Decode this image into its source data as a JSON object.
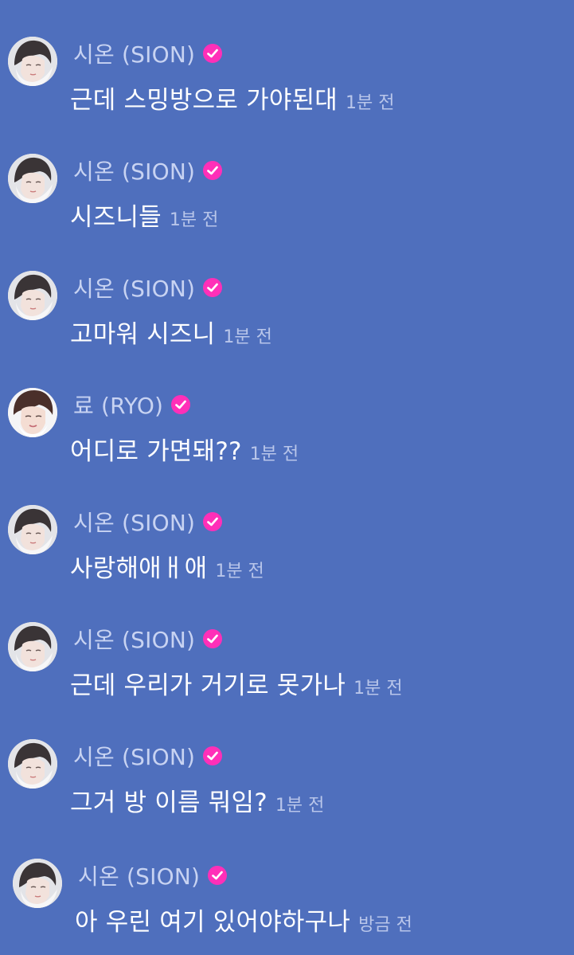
{
  "colors": {
    "background": "#4f6fbd",
    "sender_name": "#c8d3f2",
    "message_text": "#ffffff",
    "timestamp": "#b9c6ea",
    "verified_badge": "#ff2fb8"
  },
  "messages": [
    {
      "sender": "시온 (SION)",
      "text": "근데 스밍방으로 가야된대",
      "time": "1분 전",
      "avatar": "sion-avatar"
    },
    {
      "sender": "시온 (SION)",
      "text": "시즈니들",
      "time": "1분 전",
      "avatar": "sion-avatar"
    },
    {
      "sender": "시온 (SION)",
      "text": "고마워 시즈니",
      "time": "1분 전",
      "avatar": "sion-avatar"
    },
    {
      "sender": "료 (RYO)",
      "text": "어디로 가면돼??",
      "time": "1분 전",
      "avatar": "ryo-avatar"
    },
    {
      "sender": "시온 (SION)",
      "text": "사랑해애ㅐ애",
      "time": "1분 전",
      "avatar": "sion-avatar"
    },
    {
      "sender": "시온 (SION)",
      "text": "근데 우리가 거기로 못가나",
      "time": "1분 전",
      "avatar": "sion-avatar"
    },
    {
      "sender": "시온 (SION)",
      "text": "그거 방 이름 뭐임?",
      "time": "1분 전",
      "avatar": "sion-avatar"
    },
    {
      "sender": "시온 (SION)",
      "text": "아 우린 여기 있어야하구나",
      "time": "방금 전",
      "avatar": "sion-avatar"
    }
  ]
}
